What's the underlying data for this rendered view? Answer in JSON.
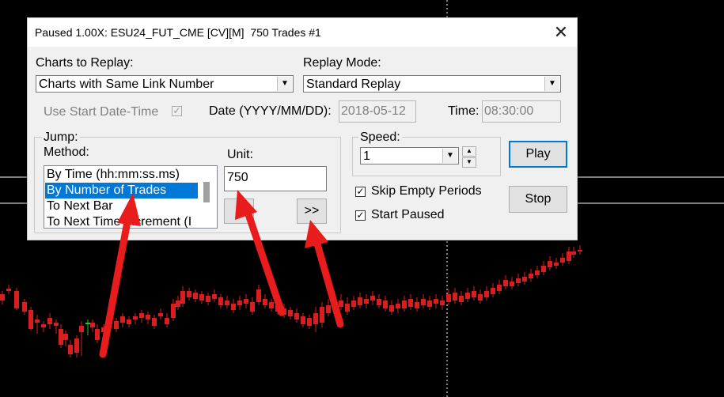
{
  "dialog": {
    "title": "Paused 1.00X: ESU24_FUT_CME [CV][M]  750 Trades #1",
    "close_glyph": "✕",
    "charts_label": "Charts to Replay:",
    "charts_value": "Charts with Same Link Number",
    "mode_label": "Replay Mode:",
    "mode_value": "Standard Replay",
    "use_start_label": "Use Start Date-Time",
    "date_label": "Date (YYYY/MM/DD):",
    "date_value": "2018-05-12",
    "time_label": "Time:",
    "time_value": "08:30:00",
    "jump_label": "Jump:",
    "method_label": "Method:",
    "methods": [
      "By Time (hh:mm:ss.ms)",
      "By Number of Trades",
      "To Next Bar",
      "To Next Time Increment (I"
    ],
    "unit_label": "Unit:",
    "unit_value": "750",
    "jump_button": ">>",
    "speed_label": "Speed:",
    "speed_value": "1",
    "play_label": "Play",
    "stop_label": "Stop",
    "skip_label": "Skip Empty Periods",
    "start_paused_label": "Start Paused",
    "check_glyph": "✓"
  },
  "colors": {
    "up": "#22c322",
    "down": "#d81e1e",
    "annotation": "#e81c1c",
    "selection": "#0078d7"
  }
}
